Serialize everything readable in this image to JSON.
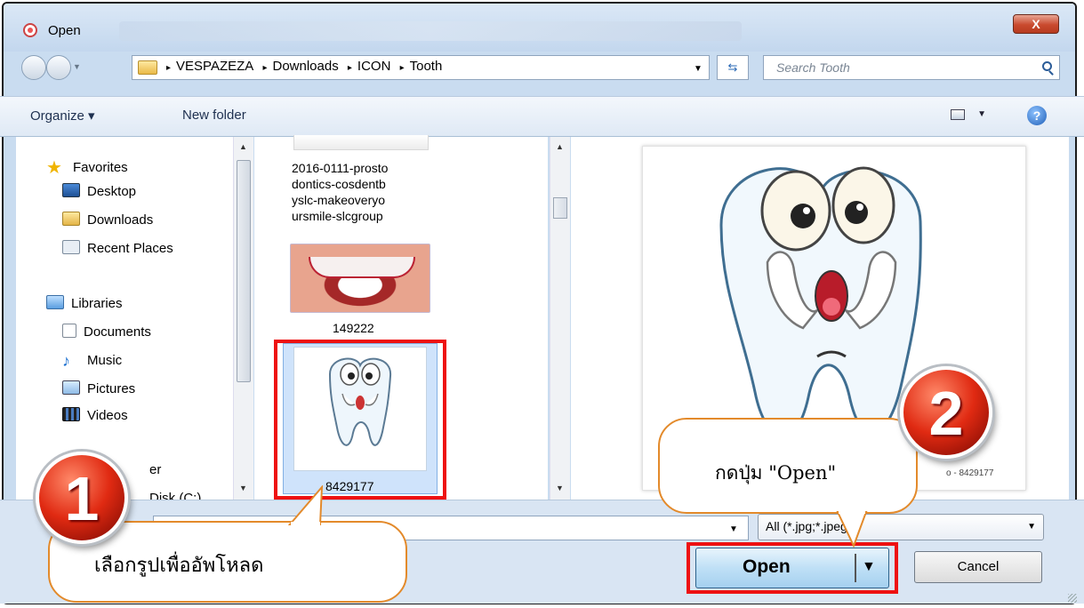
{
  "window": {
    "title": "Open",
    "close_label": "X"
  },
  "address": {
    "crumbs": [
      "VESPAZEZA",
      "Downloads",
      "ICON",
      "Tooth"
    ],
    "crumb_sep": "▸",
    "search_placeholder": "Search Tooth"
  },
  "toolbar": {
    "organize": "Organize ▾",
    "new_folder": "New folder",
    "help": "?"
  },
  "sidebar": {
    "favorites": [
      "Favorites",
      "Desktop",
      "Downloads",
      "Recent Places"
    ],
    "libraries": [
      "Libraries",
      "Documents",
      "Music",
      "Pictures",
      "Videos"
    ],
    "computer_partial": "er",
    "disk_partial": "Disk (C:)"
  },
  "files": [
    {
      "label_lines": [
        "2016-0111-prosto",
        "dontics-cosdentb",
        "yslc-makeoveryo",
        "ursmile-slcgroup"
      ]
    },
    {
      "label": "149222"
    },
    {
      "label": "8429177",
      "selected": true
    }
  ],
  "preview": {
    "caption": "o - 8429177",
    "image": "cartoon-tooth-shouting"
  },
  "footer": {
    "filter": "All (*.jpg;*.jpeg)",
    "open_label": "Open",
    "cancel_label": "Cancel"
  },
  "annotations": {
    "step1_number": "1",
    "step1_text": "เลือกรูปเพื่ออัพโหลด",
    "step2_number": "2",
    "step2_text": "กดปุ่ม \"Open\""
  },
  "colors": {
    "highlight": "#ee1111",
    "callout_border": "#e38a2b",
    "selection": "#cfe3fb"
  }
}
